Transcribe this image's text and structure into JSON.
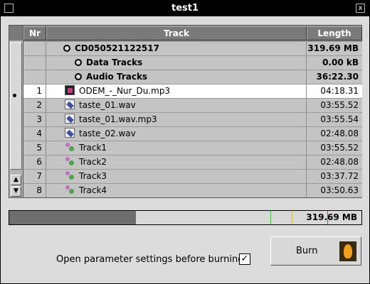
{
  "window": {
    "title": "test1",
    "close_glyph": "x"
  },
  "table": {
    "columns": {
      "nr": "Nr",
      "track": "Track",
      "length": "Length"
    },
    "rows": [
      {
        "nr": "",
        "track": "CD050521122517",
        "length": "319.69 MB",
        "kind": "root"
      },
      {
        "nr": "",
        "track": "Data Tracks",
        "length": "0.00 kB",
        "kind": "group"
      },
      {
        "nr": "",
        "track": "Audio Tracks",
        "length": "36:22.30",
        "kind": "group"
      },
      {
        "nr": "1",
        "track": "ODEM_-_Nur_Du.mp3",
        "length": "04:18.31",
        "icon": "mp3-file-icon"
      },
      {
        "nr": "2",
        "track": "taste_01.wav",
        "length": "03:55.52",
        "icon": "wav-file-icon"
      },
      {
        "nr": "3",
        "track": "taste_01.wav.mp3",
        "length": "03:55.54",
        "icon": "wav-file-icon"
      },
      {
        "nr": "4",
        "track": "taste_02.wav",
        "length": "02:48.08",
        "icon": "wav-file-icon"
      },
      {
        "nr": "5",
        "track": "Track1",
        "length": "03:55.52",
        "icon": "cd-track-icon"
      },
      {
        "nr": "6",
        "track": "Track2",
        "length": "02:48.08",
        "icon": "cd-track-icon"
      },
      {
        "nr": "7",
        "track": "Track3",
        "length": "03:37.72",
        "icon": "cd-track-icon"
      },
      {
        "nr": "8",
        "track": "Track4",
        "length": "03:50.63",
        "icon": "cd-track-icon"
      }
    ],
    "selected_row": "1"
  },
  "scrollbar": {
    "up_glyph": "▲",
    "down_glyph": "▼"
  },
  "progress": {
    "label": "319.69 MB",
    "fraction": 0.36
  },
  "options": {
    "open_params_label": "Open parameter settings before burning",
    "open_params_checked_glyph": "✓"
  },
  "burn": {
    "label": "Burn",
    "icon": "flame-icon"
  },
  "colors": {
    "title_bg": "#000000",
    "selection": "#ffffff",
    "row_bg": "#c4c4c4",
    "progress_fill": "#6e6e6e"
  }
}
